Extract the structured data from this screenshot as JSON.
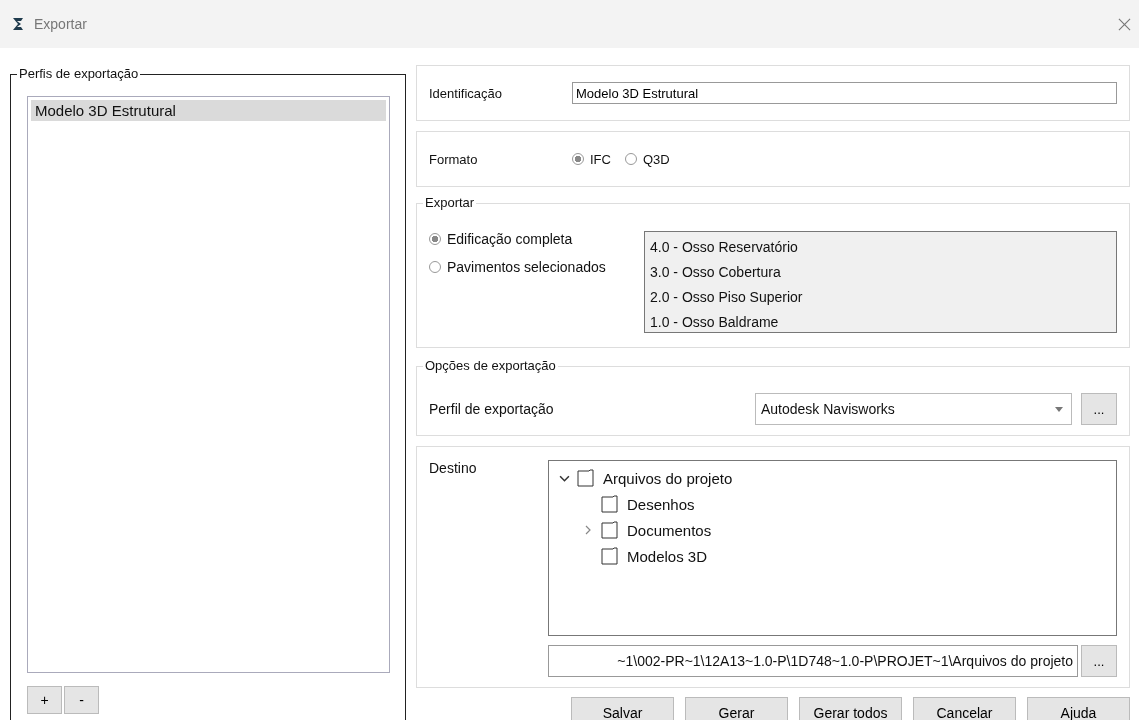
{
  "window": {
    "title": "Exportar"
  },
  "profiles": {
    "legend": "Perfis de exportação",
    "items": [
      {
        "label": "Modelo 3D Estrutural",
        "selected": true
      }
    ],
    "buttons": [
      "+",
      "-"
    ]
  },
  "identification": {
    "label": "Identificação",
    "value": "Modelo 3D Estrutural"
  },
  "format": {
    "label": "Formato",
    "options": [
      {
        "label": "IFC",
        "selected": true
      },
      {
        "label": "Q3D",
        "selected": false
      }
    ]
  },
  "export": {
    "legend": "Exportar",
    "options": [
      {
        "label": "Edificação completa",
        "selected": true
      },
      {
        "label": "Pavimentos selecionados",
        "selected": false
      }
    ],
    "floors": [
      "4.0 - Osso Reservatório",
      "3.0 - Osso Cobertura",
      "2.0 - Osso Piso Superior",
      "1.0 - Osso Baldrame"
    ]
  },
  "export_options": {
    "legend": "Opções de exportação",
    "label": "Perfil de exportação",
    "value": "Autodesk Navisworks",
    "browse": "..."
  },
  "destination": {
    "label": "Destino",
    "tree": [
      {
        "label": "Arquivos do projeto",
        "expanded": true,
        "children": [
          {
            "label": "Desenhos"
          },
          {
            "label": "Documentos",
            "expanded": false
          },
          {
            "label": "Modelos 3D"
          }
        ]
      }
    ],
    "path": "~1\\002-PR~1\\12A13~1.0-P\\1D748~1.0-P\\PROJET~1\\Arquivos do projeto",
    "browse": "..."
  },
  "buttons": [
    "Salvar",
    "Gerar",
    "Gerar todos",
    "Cancelar",
    "Ajuda"
  ]
}
